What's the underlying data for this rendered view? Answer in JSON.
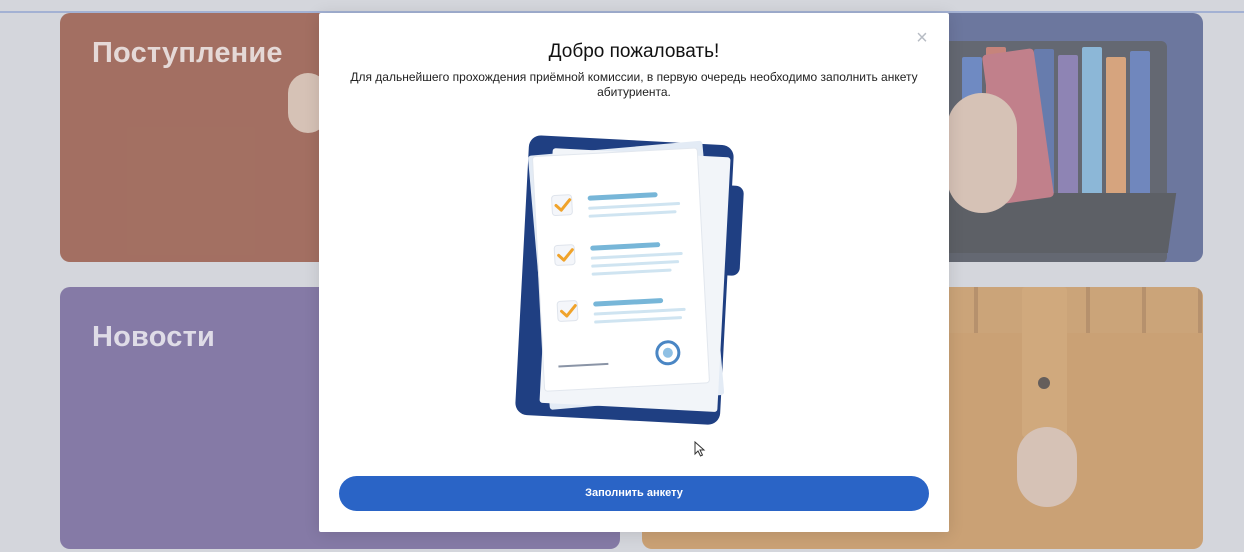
{
  "tiles": {
    "admission": {
      "title": "Поступление"
    },
    "news": {
      "title": "Новости"
    }
  },
  "modal": {
    "close_icon": "×",
    "title": "Добро пожаловать!",
    "subtitle": "Для дальнейшего прохождения приёмной комиссии, в первую очередь необходимо заполнить анкету абитуриента.",
    "primary_button": "Заполнить анкету",
    "illustration_icon": "checklist-document-icon"
  },
  "colors": {
    "accent": "#2a64c6",
    "admission_tile": "#8a3a22",
    "news_tile": "#5c4a8a",
    "library_tile": "#36457e",
    "archive_tile": "#c7863f",
    "check_orange": "#f0a32b",
    "folder_navy": "#1f3f82"
  }
}
